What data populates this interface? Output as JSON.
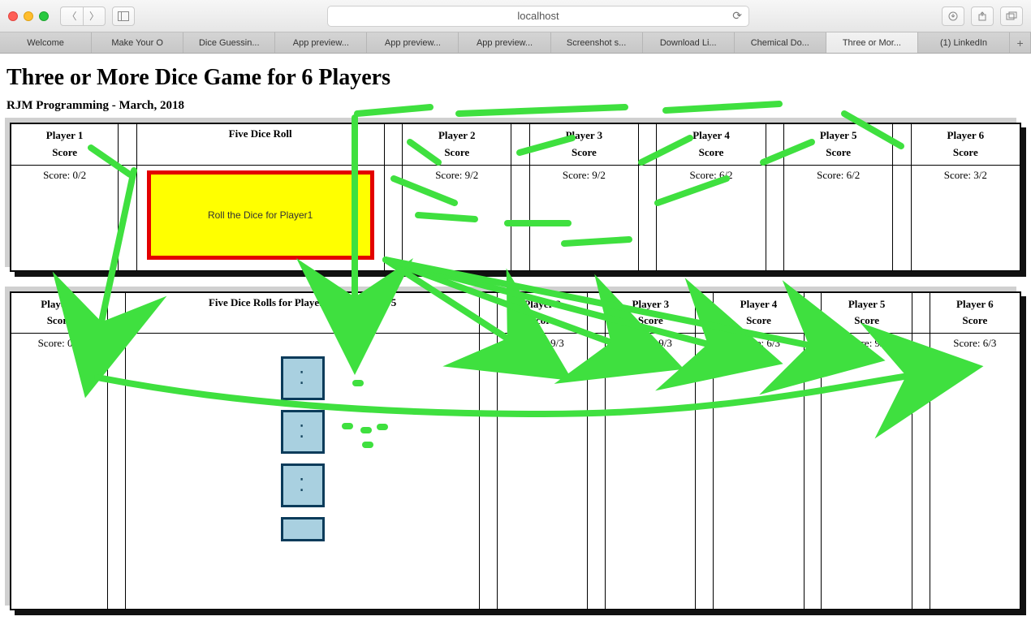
{
  "browser": {
    "url": "localhost",
    "tabs": [
      {
        "label": "Welcome",
        "active": false
      },
      {
        "label": "Make Your O",
        "active": false
      },
      {
        "label": "Dice Guessin...",
        "active": false
      },
      {
        "label": "App preview...",
        "active": false
      },
      {
        "label": "App preview...",
        "active": false
      },
      {
        "label": "App preview...",
        "active": false
      },
      {
        "label": "Screenshot s...",
        "active": false
      },
      {
        "label": "Download Li...",
        "active": false
      },
      {
        "label": "Chemical Do...",
        "active": false
      },
      {
        "label": "Three or Mor...",
        "active": true
      },
      {
        "label": "(1) LinkedIn",
        "active": false
      }
    ]
  },
  "page": {
    "title": "Three or More Dice Game for 6 Players",
    "subtitle": "RJM Programming - March, 2018"
  },
  "topPanel": {
    "headers": {
      "p1": "Player 1",
      "p2": "Player 2",
      "p3": "Player 3",
      "p4": "Player 4",
      "p5": "Player 5",
      "p6": "Player 6",
      "score": "Score",
      "rollTitle": "Five Dice Roll"
    },
    "scores": {
      "p1": "Score: 0/2",
      "p2": "Score: 9/2",
      "p3": "Score: 9/2",
      "p4": "Score: 6/2",
      "p5": "Score: 6/2",
      "p6": "Score: 3/2"
    },
    "rollButton": "Roll the Dice for Player1"
  },
  "bottomPanel": {
    "headers": {
      "p1": "Player 1",
      "p2": "Player 2",
      "p3": "Player 3",
      "p4": "Player 4",
      "p5": "Player 5",
      "p6": "Player 6",
      "score": "Score",
      "rollTitle": "Five Dice Rolls for Player6 are 2, 2, 2, 1, 5"
    },
    "scores": {
      "p1": "Score: 0/3",
      "p2": "Score: 9/3",
      "p3": "Score: 9/3",
      "p4": "Score: 6/3",
      "p5": "Score: 9/3",
      "p6": "Score: 6/3"
    },
    "diceFaces": [
      "⁚",
      "⁚",
      "⁚",
      ""
    ]
  }
}
